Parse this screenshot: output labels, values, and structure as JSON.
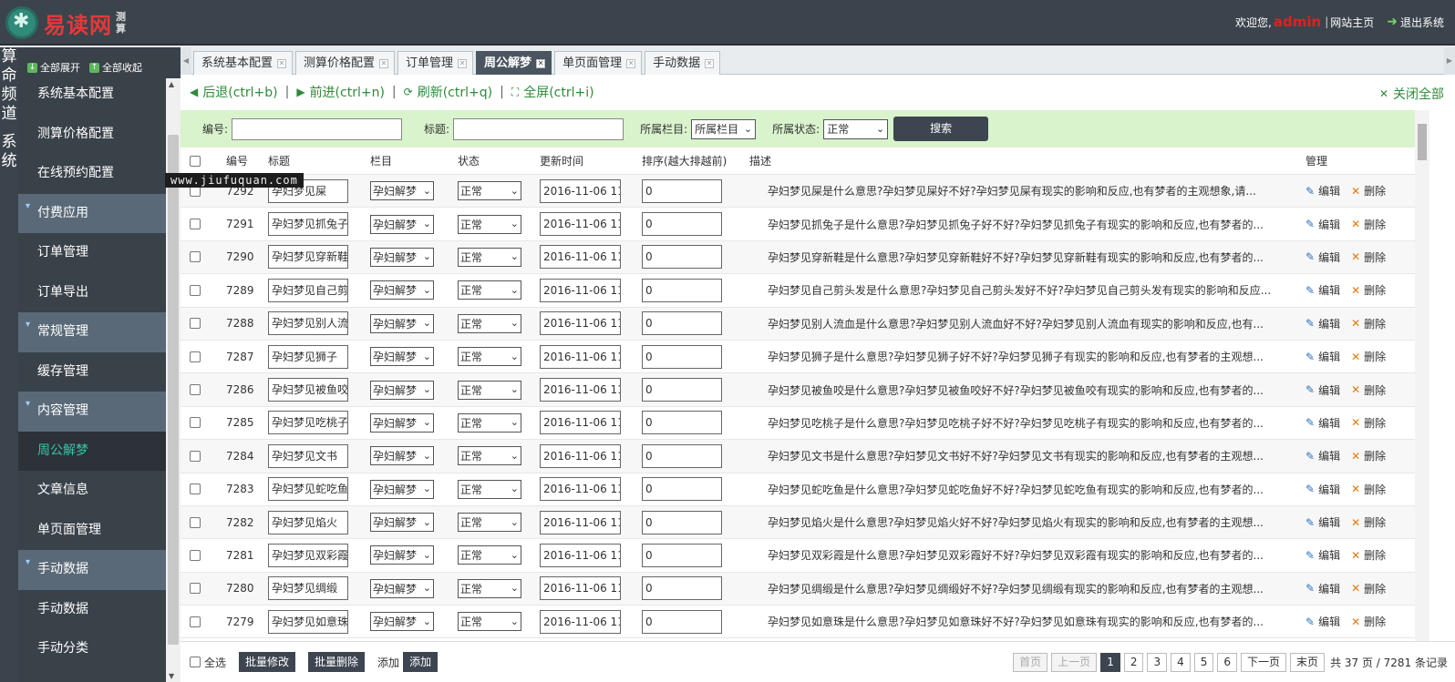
{
  "header": {
    "logo_text": "易读网",
    "logo_sub": "测算",
    "welcome": "欢迎您,",
    "username": "admin",
    "site_home": "网站主页",
    "logout": "退出系统"
  },
  "left_strip": {
    "chars": [
      "算",
      "命",
      "频",
      "道",
      "",
      "系",
      "统"
    ]
  },
  "sidebar": {
    "expand_all": "全部展开",
    "collapse_all": "全部收起",
    "items": [
      {
        "label": "系统基本配置",
        "type": "item"
      },
      {
        "label": "测算价格配置",
        "type": "item"
      },
      {
        "label": "在线预约配置",
        "type": "item"
      },
      {
        "label": "付费应用",
        "type": "group"
      },
      {
        "label": "订单管理",
        "type": "item"
      },
      {
        "label": "订单导出",
        "type": "item"
      },
      {
        "label": "常规管理",
        "type": "group"
      },
      {
        "label": "缓存管理",
        "type": "item"
      },
      {
        "label": "内容管理",
        "type": "group"
      },
      {
        "label": "周公解梦",
        "type": "active"
      },
      {
        "label": "文章信息",
        "type": "item"
      },
      {
        "label": "单页面管理",
        "type": "item"
      },
      {
        "label": "手动数据",
        "type": "group"
      },
      {
        "label": "手动数据",
        "type": "item"
      },
      {
        "label": "手动分类",
        "type": "item"
      }
    ]
  },
  "tabs": [
    {
      "label": "系统基本配置",
      "active": false
    },
    {
      "label": "测算价格配置",
      "active": false
    },
    {
      "label": "订单管理",
      "active": false
    },
    {
      "label": "周公解梦",
      "active": true
    },
    {
      "label": "单页面管理",
      "active": false
    },
    {
      "label": "手动数据",
      "active": false
    }
  ],
  "toolbar": {
    "back": "后退(ctrl+b)",
    "forward": "前进(ctrl+n)",
    "refresh": "刷新(ctrl+q)",
    "fullscreen": "全屏(ctrl+i)",
    "close_all": "关闭全部"
  },
  "search": {
    "id_label": "编号:",
    "title_label": "标题:",
    "category_label": "所属栏目:",
    "category_value": "所属栏目",
    "status_label": "所属状态:",
    "status_value": "正常",
    "button": "搜索"
  },
  "table": {
    "headers": {
      "id": "编号",
      "title": "标题",
      "category": "栏目",
      "status": "状态",
      "time": "更新时间",
      "sort": "排序(越大排越前)",
      "desc": "描述",
      "manage": "管理"
    },
    "edit_label": "编辑",
    "delete_label": "删除",
    "rows": [
      {
        "id": "7292",
        "title": "孕妇梦见屎",
        "category": "孕妇解梦",
        "status": "正常",
        "time": "2016-11-06 11:",
        "sort": "0",
        "desc": "孕妇梦见屎是什么意思?孕妇梦见屎好不好?孕妇梦见屎有现实的影响和反应,也有梦者的主观想象,请..."
      },
      {
        "id": "7291",
        "title": "孕妇梦见抓兔子",
        "category": "孕妇解梦",
        "status": "正常",
        "time": "2016-11-06 11:",
        "sort": "0",
        "desc": "孕妇梦见抓兔子是什么意思?孕妇梦见抓兔子好不好?孕妇梦见抓兔子有现实的影响和反应,也有梦者的..."
      },
      {
        "id": "7290",
        "title": "孕妇梦见穿新鞋",
        "category": "孕妇解梦",
        "status": "正常",
        "time": "2016-11-06 11:",
        "sort": "0",
        "desc": "孕妇梦见穿新鞋是什么意思?孕妇梦见穿新鞋好不好?孕妇梦见穿新鞋有现实的影响和反应,也有梦者的..."
      },
      {
        "id": "7289",
        "title": "孕妇梦见自己剪",
        "category": "孕妇解梦",
        "status": "正常",
        "time": "2016-11-06 11:",
        "sort": "0",
        "desc": "孕妇梦见自己剪头发是什么意思?孕妇梦见自己剪头发好不好?孕妇梦见自己剪头发有现实的影响和反应..."
      },
      {
        "id": "7288",
        "title": "孕妇梦见别人流",
        "category": "孕妇解梦",
        "status": "正常",
        "time": "2016-11-06 11:",
        "sort": "0",
        "desc": "孕妇梦见别人流血是什么意思?孕妇梦见别人流血好不好?孕妇梦见别人流血有现实的影响和反应,也有..."
      },
      {
        "id": "7287",
        "title": "孕妇梦见狮子",
        "category": "孕妇解梦",
        "status": "正常",
        "time": "2016-11-06 11:",
        "sort": "0",
        "desc": "孕妇梦见狮子是什么意思?孕妇梦见狮子好不好?孕妇梦见狮子有现实的影响和反应,也有梦者的主观想..."
      },
      {
        "id": "7286",
        "title": "孕妇梦见被鱼咬",
        "category": "孕妇解梦",
        "status": "正常",
        "time": "2016-11-06 11:",
        "sort": "0",
        "desc": "孕妇梦见被鱼咬是什么意思?孕妇梦见被鱼咬好不好?孕妇梦见被鱼咬有现实的影响和反应,也有梦者的..."
      },
      {
        "id": "7285",
        "title": "孕妇梦见吃桃子",
        "category": "孕妇解梦",
        "status": "正常",
        "time": "2016-11-06 11:",
        "sort": "0",
        "desc": "孕妇梦见吃桃子是什么意思?孕妇梦见吃桃子好不好?孕妇梦见吃桃子有现实的影响和反应,也有梦者的..."
      },
      {
        "id": "7284",
        "title": "孕妇梦见文书",
        "category": "孕妇解梦",
        "status": "正常",
        "time": "2016-11-06 11:",
        "sort": "0",
        "desc": "孕妇梦见文书是什么意思?孕妇梦见文书好不好?孕妇梦见文书有现实的影响和反应,也有梦者的主观想..."
      },
      {
        "id": "7283",
        "title": "孕妇梦见蛇吃鱼",
        "category": "孕妇解梦",
        "status": "正常",
        "time": "2016-11-06 11:",
        "sort": "0",
        "desc": "孕妇梦见蛇吃鱼是什么意思?孕妇梦见蛇吃鱼好不好?孕妇梦见蛇吃鱼有现实的影响和反应,也有梦者的..."
      },
      {
        "id": "7282",
        "title": "孕妇梦见焰火",
        "category": "孕妇解梦",
        "status": "正常",
        "time": "2016-11-06 11:",
        "sort": "0",
        "desc": "孕妇梦见焰火是什么意思?孕妇梦见焰火好不好?孕妇梦见焰火有现实的影响和反应,也有梦者的主观想..."
      },
      {
        "id": "7281",
        "title": "孕妇梦见双彩霞",
        "category": "孕妇解梦",
        "status": "正常",
        "time": "2016-11-06 11:",
        "sort": "0",
        "desc": "孕妇梦见双彩霞是什么意思?孕妇梦见双彩霞好不好?孕妇梦见双彩霞有现实的影响和反应,也有梦者的..."
      },
      {
        "id": "7280",
        "title": "孕妇梦见绸缎",
        "category": "孕妇解梦",
        "status": "正常",
        "time": "2016-11-06 11:",
        "sort": "0",
        "desc": "孕妇梦见绸缎是什么意思?孕妇梦见绸缎好不好?孕妇梦见绸缎有现实的影响和反应,也有梦者的主观想..."
      },
      {
        "id": "7279",
        "title": "孕妇梦见如意珠",
        "category": "孕妇解梦",
        "status": "正常",
        "time": "2016-11-06 11:",
        "sort": "0",
        "desc": "孕妇梦见如意珠是什么意思?孕妇梦见如意珠好不好?孕妇梦见如意珠有现实的影响和反应,也有梦者的..."
      }
    ]
  },
  "footer": {
    "select_all": "全选",
    "batch_edit": "批量修改",
    "batch_delete": "批量删除",
    "add_label": "添加",
    "add_button": "添加"
  },
  "pager": {
    "first": "首页",
    "prev": "上一页",
    "pages": [
      "1",
      "2",
      "3",
      "4",
      "5",
      "6"
    ],
    "current": "1",
    "next": "下一页",
    "last": "末页",
    "info": "共 37 页 / 7281 条记录"
  },
  "watermark": "www.jiufuquan.com",
  "icons": {
    "expand": "plus-icon",
    "collapse": "minus-icon",
    "back": "arrow-left-icon",
    "forward": "arrow-right-icon",
    "refresh": "refresh-icon",
    "fullscreen": "fullscreen-icon",
    "close_all": "close-icon",
    "edit": "pencil-icon",
    "delete": "x-icon",
    "logout": "exit-icon"
  },
  "colors": {
    "topbar": "#3b444c",
    "sidebar": "#394149",
    "accent_green": "#2e8a3a",
    "search_bg": "#d9f3cc",
    "admin": "#e02020"
  }
}
